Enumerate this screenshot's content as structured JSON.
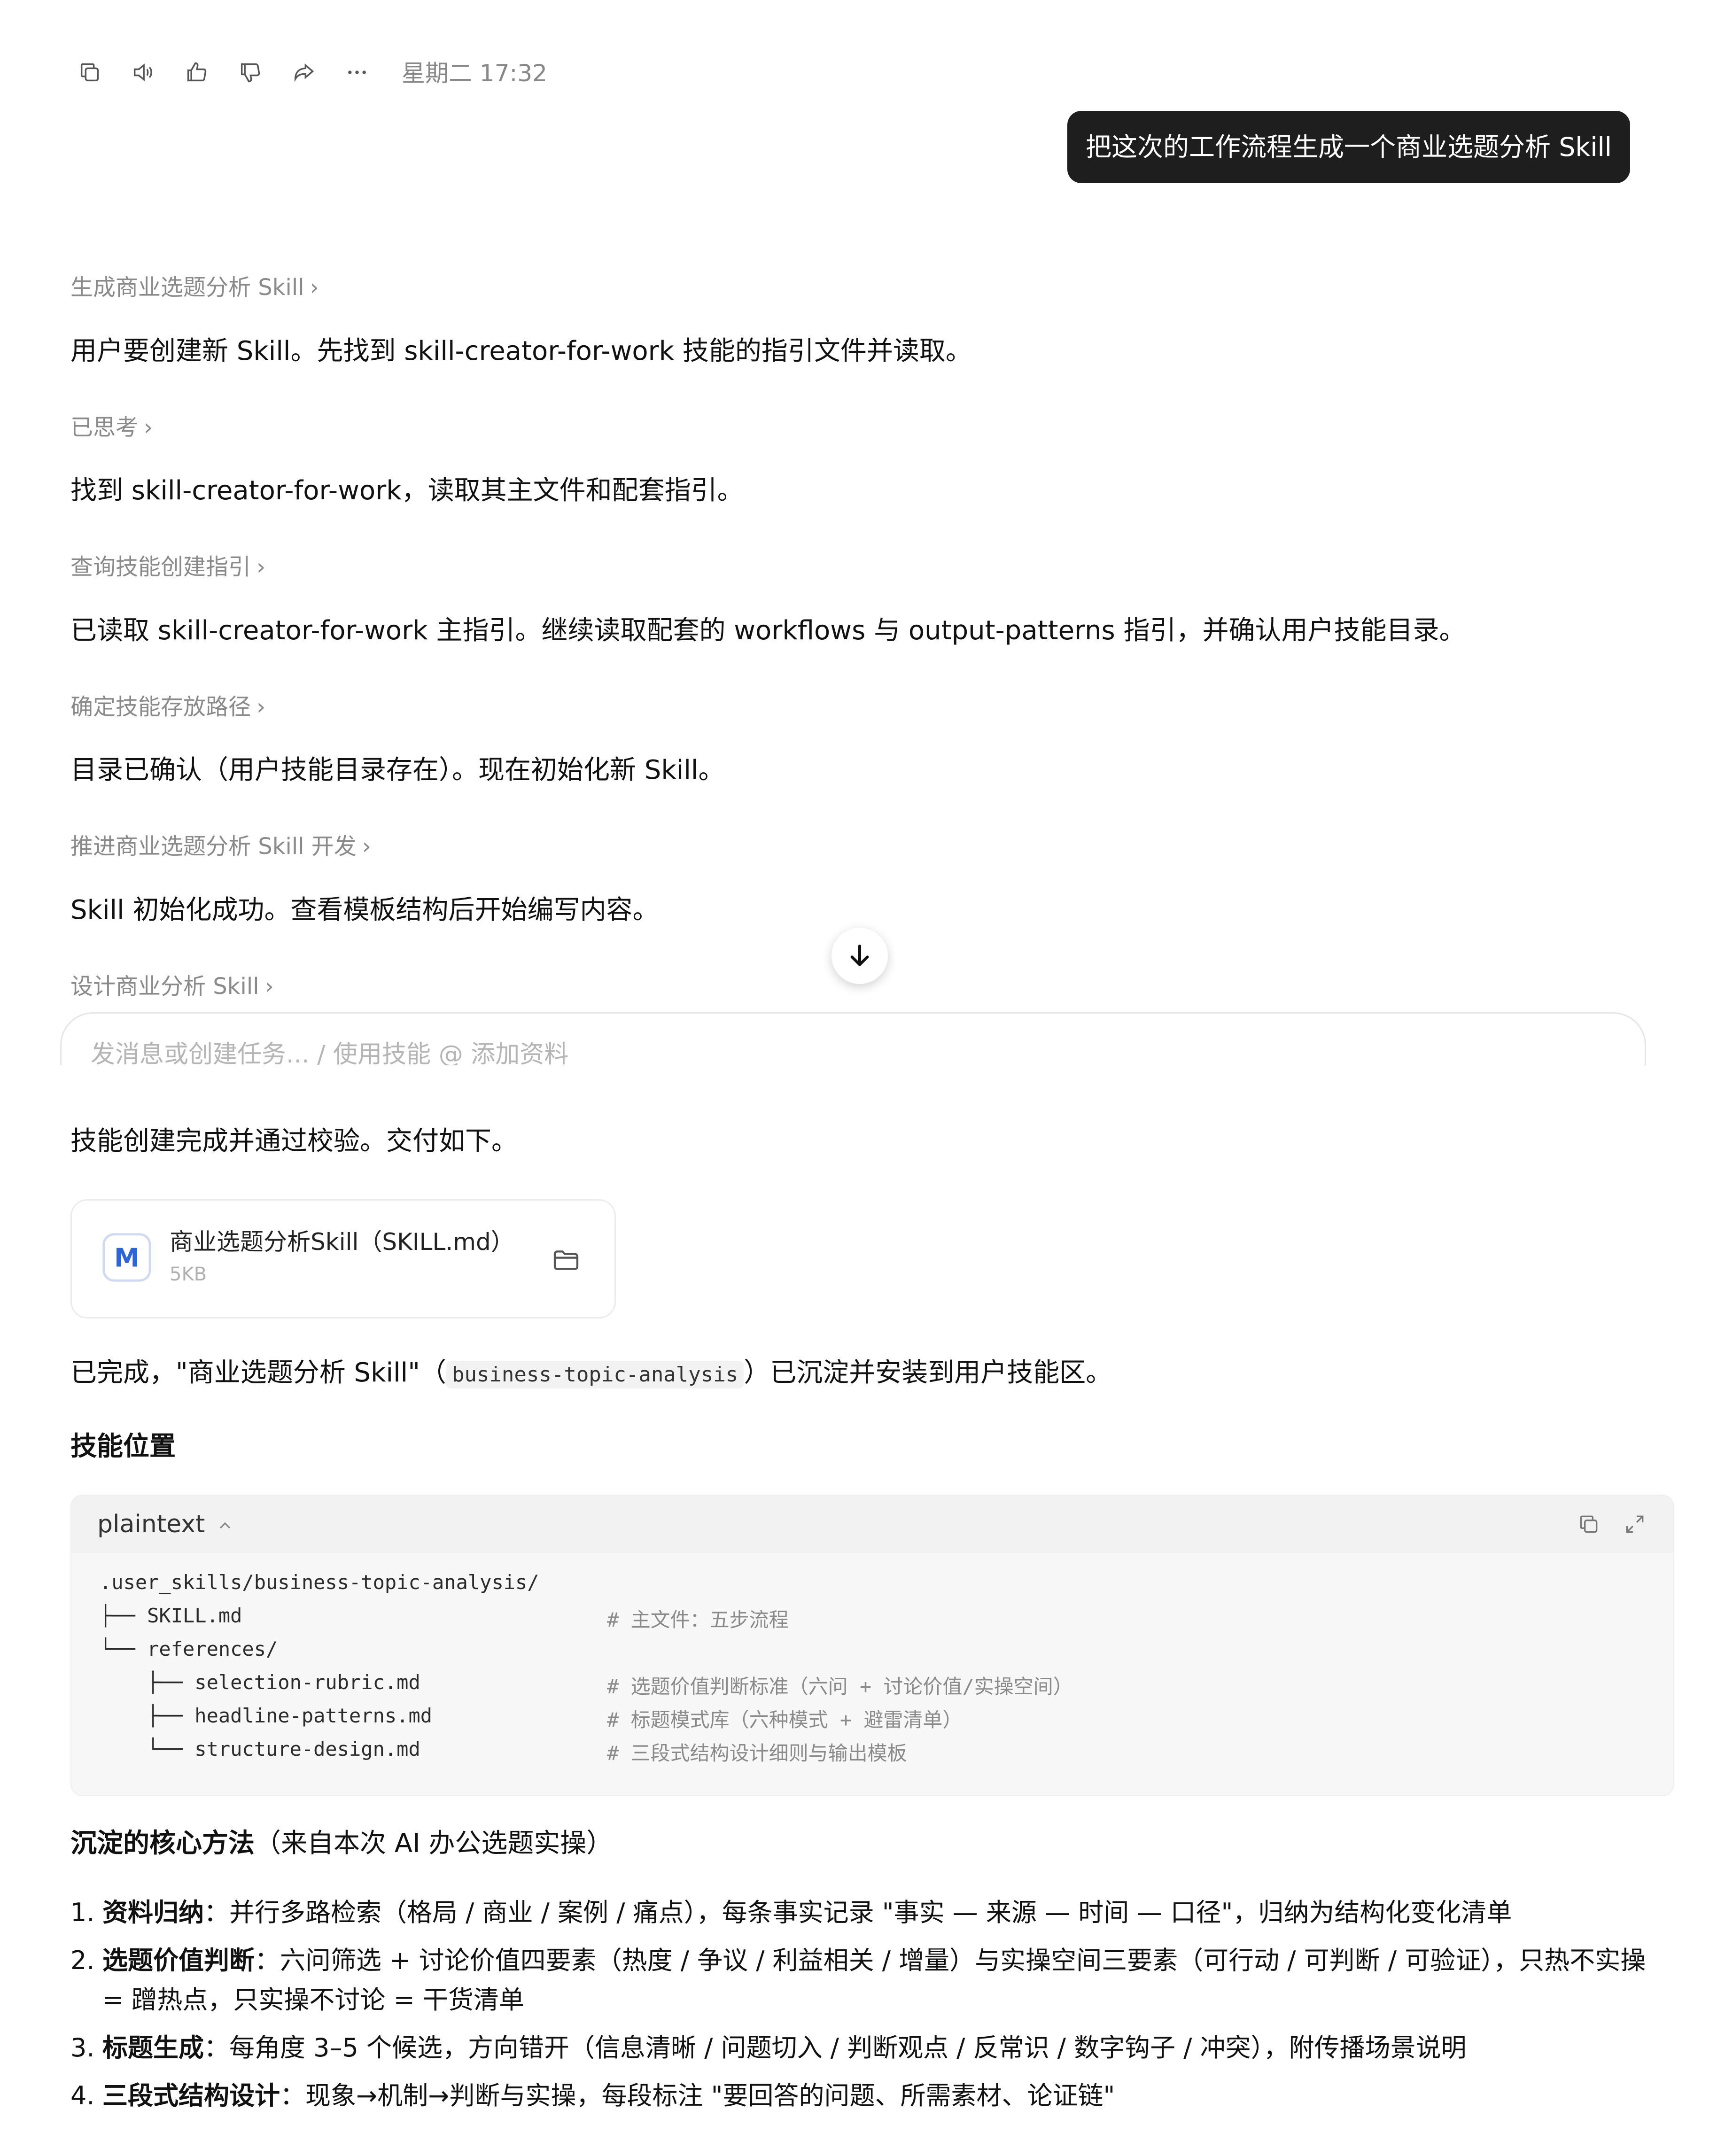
{
  "message_actions": {
    "timestamp": "星期二 17:32",
    "icons": [
      "copy-icon",
      "speaker-icon",
      "thumbs-up-icon",
      "thumbs-down-icon",
      "share-icon",
      "more-icon"
    ]
  },
  "user_message": "把这次的工作流程生成一个商业选题分析 Skill",
  "steps": [
    {
      "title": "生成商业选题分析 Skill",
      "text": "用户要创建新 Skill。先找到 skill-creator-for-work 技能的指引文件并读取。"
    },
    {
      "title": "已思考",
      "text": "找到 skill-creator-for-work，读取其主文件和配套指引。"
    },
    {
      "title": "查询技能创建指引",
      "text": "已读取 skill-creator-for-work 主指引。继续读取配套的 workflows 与 output-patterns 指引，并确认用户技能目录。"
    },
    {
      "title": "确定技能存放路径",
      "text": "目录已确认（用户技能目录存在）。现在初始化新 Skill。"
    },
    {
      "title": "推进商业选题分析 Skill 开发",
      "text": "Skill 初始化成功。查看模板结构后开始编写内容。"
    },
    {
      "title": "设计商业分析 Skill",
      "text": ""
    }
  ],
  "chevron": "›",
  "composer": {
    "placeholder": "发消息或创建任务... / 使用技能 @ 添加资料"
  },
  "result": {
    "intro": "技能创建完成并通过校验。交付如下。",
    "file": {
      "icon_letter": "M",
      "name": "商业选题分析Skill（SKILL.md）",
      "size": "5KB"
    },
    "done_prefix": "已完成，\"商业选题分析 Skill\"（",
    "done_code": "business-topic-analysis",
    "done_suffix": "）已沉淀并安装到用户技能区。",
    "location_heading": "技能位置",
    "code": {
      "lang": "plaintext",
      "lines": [
        {
          "path": ".user_skills/business-topic-analysis/",
          "comment": ""
        },
        {
          "path": "├── SKILL.md",
          "comment": "# 主文件：五步流程"
        },
        {
          "path": "└── references/",
          "comment": ""
        },
        {
          "path": "    ├── selection-rubric.md",
          "comment": "# 选题价值判断标准（六问 + 讨论价值/实操空间）"
        },
        {
          "path": "    ├── headline-patterns.md",
          "comment": "# 标题模式库（六种模式 + 避雷清单）"
        },
        {
          "path": "    └── structure-design.md",
          "comment": "# 三段式结构设计细则与输出模板"
        }
      ]
    },
    "method_heading_bold": "沉淀的核心方法",
    "method_heading_rest": "（来自本次 AI 办公选题实操）",
    "methods": [
      {
        "num": "1.",
        "title": "资料归纳",
        "text": "：并行多路检索（格局 / 商业 / 案例 / 痛点），每条事实记录 \"事实 — 来源 — 时间 — 口径\"，归纳为结构化变化清单"
      },
      {
        "num": "2.",
        "title": "选题价值判断",
        "text": "：六问筛选 + 讨论价值四要素（热度 / 争议 / 利益相关 / 增量）与实操空间三要素（可行动 / 可判断 / 可验证），只热不实操 = 蹭热点，只实操不讨论 = 干货清单"
      },
      {
        "num": "3.",
        "title": "标题生成",
        "text": "：每角度 3–5 个候选，方向错开（信息清晰 / 问题切入 / 判断观点 / 反常识 / 数字钩子 / 冲突），附传播场景说明"
      },
      {
        "num": "4.",
        "title": "三段式结构设计",
        "text": "：现象→机制→判断与实操，每段标注 \"要回答的问题、所需素材、论证链\""
      }
    ]
  }
}
